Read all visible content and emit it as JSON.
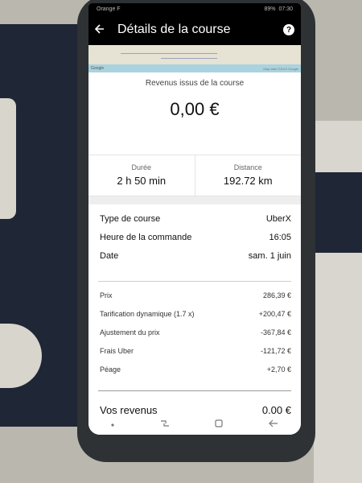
{
  "statusbar": {
    "carrier": "Orange F",
    "battery": "89%",
    "time": "07:30"
  },
  "appbar": {
    "back_icon": "arrow-left-icon",
    "title": "Détails de la course",
    "help_icon": "help-icon",
    "help_glyph": "?"
  },
  "map": {
    "google_label": "Google",
    "attribution": "Map data ©2019 Google"
  },
  "earnings": {
    "label": "Revenus issus de la course",
    "amount": "0,00 €"
  },
  "stats": {
    "duration_label": "Durée",
    "duration_value": "2 h 50 min",
    "distance_label": "Distance",
    "distance_value": "192.72 km"
  },
  "trip_info": [
    {
      "label": "Type de course",
      "value": "UberX"
    },
    {
      "label": "Heure de la commande",
      "value": "16:05"
    },
    {
      "label": "Date",
      "value": "sam. 1 juin"
    }
  ],
  "fares": [
    {
      "label": "Prix",
      "value": "286,39 €"
    },
    {
      "label": "Tarification dynamique (1.7 x)",
      "value": "+200,47 €"
    },
    {
      "label": "Ajustement du prix",
      "value": "-367,84 €"
    },
    {
      "label": "Frais Uber",
      "value": "-121,72 €"
    },
    {
      "label": "Péage",
      "value": "+2,70 €"
    }
  ],
  "total": {
    "label": "Vos revenus",
    "value": "0,00 €"
  },
  "navbar": {
    "dot_icon": "dot-icon",
    "recents_icon": "recents-icon",
    "home_icon": "home-icon",
    "back_icon": "nav-back-icon"
  },
  "colors": {
    "appbar_bg": "#000000",
    "screen_bg": "#ffffff",
    "phone_frame": "#2e3234",
    "case": "#1f2636"
  }
}
